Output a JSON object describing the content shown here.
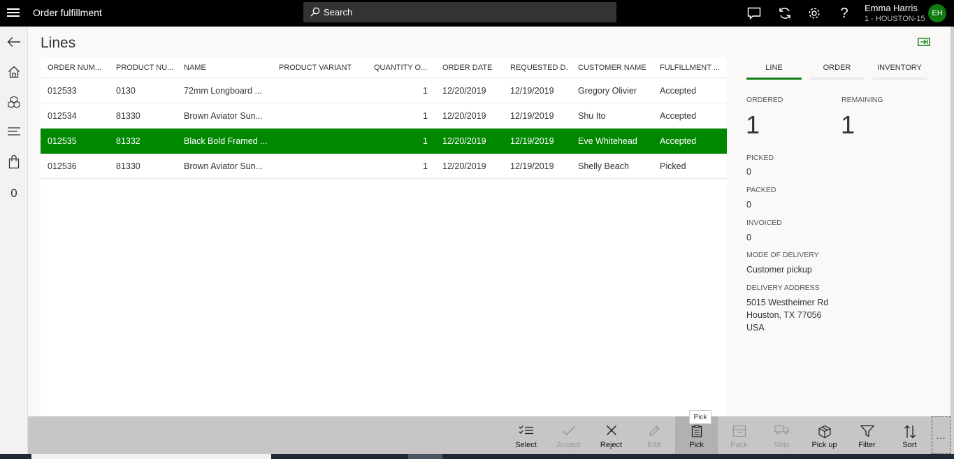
{
  "app": {
    "title": "Order fulfillment",
    "search_placeholder": "Search",
    "user_name": "Emma Harris",
    "user_store": "1 - HOUSTON-15",
    "user_initials": "EH"
  },
  "nav": {
    "count": "0"
  },
  "page": {
    "title": "Lines"
  },
  "grid": {
    "headers": [
      "ORDER NUM...",
      "PRODUCT NU...",
      "NAME",
      "PRODUCT VARIANT",
      "QUANTITY O...",
      "ORDER DATE",
      "REQUESTED D...",
      "CUSTOMER NAME",
      "FULFILLMENT ..."
    ],
    "rows": [
      [
        "012533",
        "0130",
        "72mm Longboard ...",
        "",
        "1",
        "12/20/2019",
        "12/19/2019",
        "Gregory Olivier",
        "Accepted"
      ],
      [
        "012534",
        "81330",
        "Brown Aviator Sun...",
        "",
        "1",
        "12/20/2019",
        "12/19/2019",
        "Shu Ito",
        "Accepted"
      ],
      [
        "012535",
        "81332",
        "Black Bold Framed ...",
        "",
        "1",
        "12/20/2019",
        "12/19/2019",
        "Eve Whitehead",
        "Accepted"
      ],
      [
        "012536",
        "81330",
        "Brown Aviator Sun...",
        "",
        "1",
        "12/20/2019",
        "12/19/2019",
        "Shelly Beach",
        "Picked"
      ]
    ],
    "selected_row": "012535"
  },
  "details": {
    "tabs": [
      "LINE",
      "ORDER",
      "INVENTORY"
    ],
    "active_tab": "LINE",
    "ordered_label": "ORDERED",
    "ordered_value": "1",
    "remaining_label": "REMAINING",
    "remaining_value": "1",
    "picked_label": "PICKED",
    "picked_value": "0",
    "packed_label": "PACKED",
    "packed_value": "0",
    "invoiced_label": "INVOICED",
    "invoiced_value": "0",
    "mode_label": "MODE OF DELIVERY",
    "mode_value": "Customer pickup",
    "address_label": "DELIVERY ADDRESS",
    "address_line1": "5015 Westheimer Rd",
    "address_line2": "Houston, TX 77056",
    "address_line3": "USA"
  },
  "commands": {
    "select": "Select",
    "accept": "Accept",
    "reject": "Reject",
    "edit": "Edit",
    "pick": "Pick",
    "pack": "Pack",
    "ship": "Ship",
    "pickup": "Pick up",
    "filter": "Filter",
    "sort": "Sort",
    "more": "...",
    "tooltip": "Pick"
  },
  "colors": {
    "accent": "#107c10",
    "selected_row": "#008800",
    "topbar": "#000000",
    "command_bar": "#c8c6c4"
  }
}
